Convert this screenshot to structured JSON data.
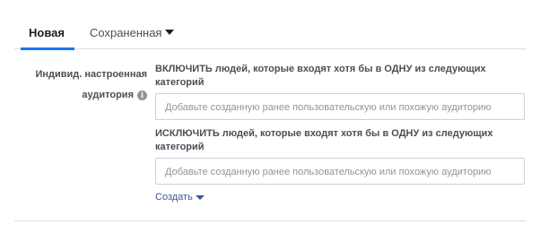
{
  "tabs": {
    "new_label": "Новая",
    "saved_label": "Сохраненная"
  },
  "field": {
    "label_line1": "Индивид. настроенная",
    "label_line2": "аудитория"
  },
  "include": {
    "title": "ВКЛЮЧИТЬ людей, которые входят хотя бы в ОДНУ из следующих категорий",
    "placeholder": "Добавьте созданную ранее пользовательскую или похожую аудиторию"
  },
  "exclude": {
    "title": "ИСКЛЮЧИТЬ людей, которые входят хотя бы в ОДНУ из следующих категорий",
    "placeholder": "Добавьте созданную ранее пользовательскую или похожую аудиторию"
  },
  "create": {
    "label": "Создать"
  },
  "icons": {
    "info": "i"
  },
  "colors": {
    "accent": "#1877f2",
    "link": "#385898"
  }
}
